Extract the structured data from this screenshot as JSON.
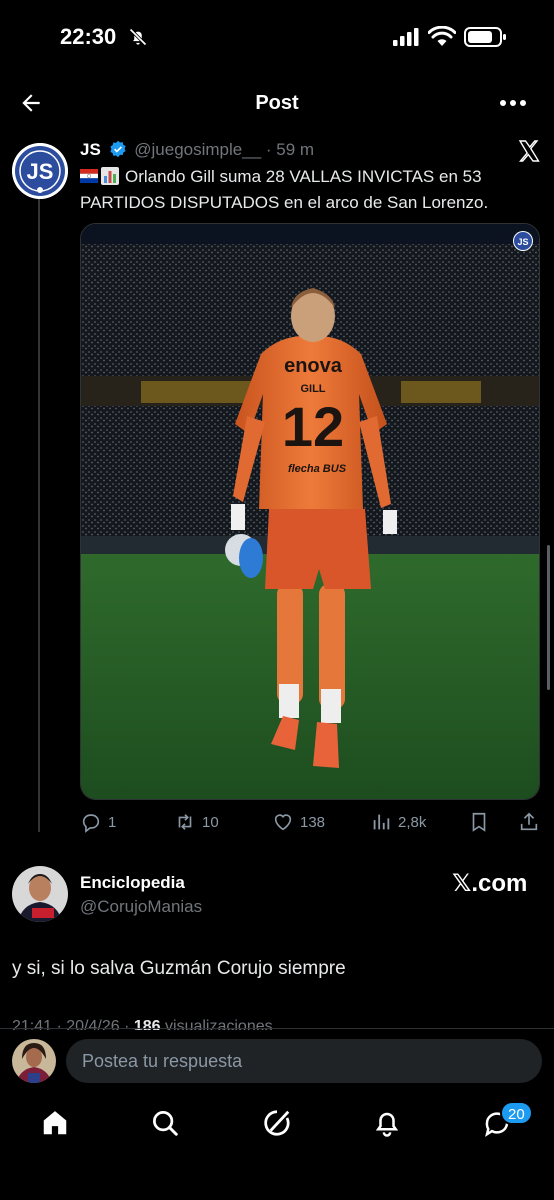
{
  "status_bar": {
    "time": "22:30"
  },
  "header": {
    "title": "Post"
  },
  "quoted_tweet": {
    "name": "JS",
    "handle": "@juegosimple__",
    "time": "· 59 m",
    "text": "Orlando Gill suma 28 VALLAS INVICTAS en 53 PARTIDOS DISPUTADOS en el arco de San Lorenzo.",
    "avatar_text": "JS",
    "jersey": {
      "sponsor": "enova",
      "name": "GILL",
      "number": "12",
      "sleeve_sponsor": "flecha BUS"
    },
    "actions": {
      "replies": "1",
      "reposts": "10",
      "likes": "138",
      "views": "2,8k"
    }
  },
  "main_tweet": {
    "name": "Enciclopedia",
    "handle": "@CorujoManias",
    "source": "𝕏.com",
    "text": "y si, si lo salva Guzmán Corujo siempre",
    "meta_time": "21:41 · 20/4/26 · ",
    "meta_views": "186",
    "meta_views_label": " visualizaciones"
  },
  "reply": {
    "placeholder": "Postea tu respuesta"
  },
  "bottom_nav": {
    "messages_badge": "20"
  },
  "colors": {
    "accent": "#1d9bf0",
    "background": "#000000",
    "muted": "#71767b"
  }
}
